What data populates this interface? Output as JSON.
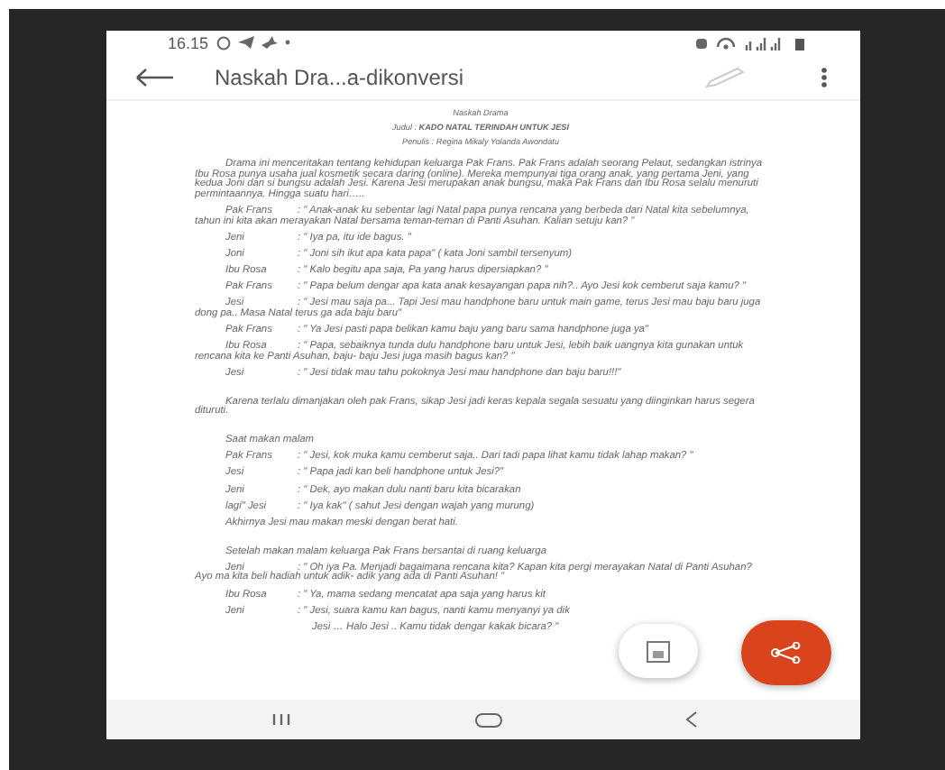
{
  "status_bar": {
    "time": "16.15"
  },
  "app_bar": {
    "title": "Naskah Dra...a-dikonversi"
  },
  "document": {
    "heading": "Naskah Drama",
    "title_line": "Judul : **KADO NATAL TERINDAH UNTUK JESI**",
    "author": "Penulis : Regina Mikaly Yolanda Awondatu",
    "sections": [
      {
        "blocks": [
          {
            "kind": "paragraph",
            "text": "Drama ini menceritakan tentang kehidupan keluarga Pak Frans. Pak Frans adalah seorang Pelaut, sedangkan istrinya Ibu Rosa punya usaha jual kosmetik secara daring (online). Mereka mempunyai tiga orang anak, yang pertama Jeni, yang kedua Joni dan si bungsu adalah Jesi. Karena Jesi merupakan anak bungsu, maka Pak Frans dan Ibu Rosa selalu menuruti permintaannya. Hingga suatu hari….."
          },
          {
            "kind": "dialogue",
            "speaker": "Pak Frans",
            "text": ": \" Anak-anak ku sebentar lagi Natal papa punya rencana yang berbeda dari Natal kita sebelumnya, tahun ini kita akan merayakan Natal bersama teman-teman di Panti Asuhan. Kalian setuju kan? \""
          },
          {
            "kind": "dialogue",
            "speaker": "Jeni",
            "text": ": \" Iya pa, itu ide bagus. \""
          },
          {
            "kind": "dialogue",
            "speaker": "Joni",
            "text": ": \" Joni sih ikut apa kata papa\" ( kata Joni sambil tersenyum)"
          },
          {
            "kind": "dialogue",
            "speaker": "Ibu Rosa",
            "text": ": \" Kalo begitu apa saja, Pa yang harus dipersiapkan? \""
          },
          {
            "kind": "dialogue",
            "speaker": "Pak Frans",
            "text": ": \" Papa belum dengar apa kata anak kesayangan papa nih?.. Ayo Jesi kok cemberut saja kamu? \""
          },
          {
            "kind": "dialogue",
            "speaker": "Jesi",
            "text": ": \" Jesi mau saja pa... Tapi Jesi mau handphone baru untuk main game, terus Jesi mau baju baru juga dong pa.. Masa Natal terus ga ada baju baru\""
          },
          {
            "kind": "dialogue",
            "speaker": "Pak Frans",
            "text": ": \" Ya Jesi pasti papa belikan kamu baju yang baru sama handphone juga ya\""
          },
          {
            "kind": "dialogue",
            "speaker": "Ibu Rosa",
            "text": ": \" Papa, sebaiknya tunda dulu handphone baru untuk Jesi, lebih baik uangnya kita gunakan untuk rencana kita ke Panti Asuhan, baju- baju Jesi juga masih bagus kan? \""
          },
          {
            "kind": "dialogue",
            "speaker": "Jesi",
            "text": ": \" Jesi tidak mau tahu pokoknya Jesi mau handphone dan baju baru!!!\""
          }
        ]
      },
      {
        "blocks": [
          {
            "kind": "paragraph",
            "text": "Karena terlalu dimanjakan oleh pak Frans, sikap Jesi jadi keras kepala segala sesuatu yang diinginkan harus segera dituruti."
          }
        ]
      },
      {
        "blocks": [
          {
            "kind": "scene",
            "text": "Saat makan malam"
          },
          {
            "kind": "dialogue",
            "speaker": "Pak Frans",
            "text": ": \" Jesi, kok muka kamu cemberut saja.. Dari tadi papa lihat kamu tidak lahap makan? \""
          },
          {
            "kind": "dialogue",
            "speaker": "Jesi",
            "text": ": \" Papa jadi kan beli handphone untuk Jesi?\""
          },
          {
            "kind": "dialogue",
            "speaker": "Jeni",
            "text": ": \" Dek, ayo makan dulu nanti baru kita bicarakan"
          },
          {
            "kind": "dialogue",
            "speaker": "lagi\" Jesi",
            "text": ": \" Iya kak\" ( sahut Jesi dengan wajah yang murung)"
          },
          {
            "kind": "scene",
            "text": "Akhirnya Jesi mau makan meski dengan berat hati."
          }
        ]
      },
      {
        "blocks": [
          {
            "kind": "scene",
            "text": "Setelah makan malam keluarga Pak Frans bersantai di ruang keluarga"
          },
          {
            "kind": "dialogue",
            "speaker": "Jeni",
            "text": ": \" Oh iya Pa. Menjadi bagaimana rencana kita? Kapan kita pergi merayakan Natal di Panti Asuhan? Ayo ma kita beli hadiah untuk adik- adik yang ada di Panti Asuhan! \""
          },
          {
            "kind": "dialogue",
            "speaker": "Ibu Rosa",
            "text": ": \" Ya, mama sedang mencatat apa saja yang harus kit"
          },
          {
            "kind": "dialogue",
            "speaker": "Jeni",
            "text": ": \" Jesi, suara kamu kan bagus, nanti kamu menyanyi ya dik"
          },
          {
            "kind": "continuation",
            "text": "Jesi … Halo Jesi .. Kamu tidak dengar kakak bicara? \""
          }
        ]
      }
    ]
  }
}
